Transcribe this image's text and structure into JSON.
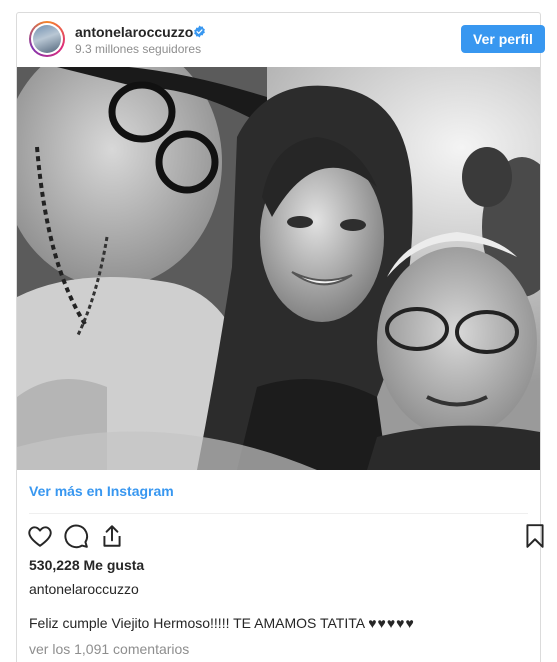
{
  "header": {
    "username": "antonelaroccuzzo",
    "followers": "9.3 millones seguidores",
    "follow_button": "Ver perfil"
  },
  "post": {
    "image_description_icon": "photo",
    "view_more": "Ver más en Instagram",
    "likes": "530,228 Me gusta",
    "author": "antonelaroccuzzo",
    "caption": "Feliz cumple Viejito Hermoso!!!!! TE AMAMOS TATITA",
    "caption_hearts": "♥♥♥♥♥",
    "comments": "ver los 1,091 comentarios"
  },
  "colors": {
    "accent": "#3897f0",
    "text": "#262626",
    "muted": "#8e8e8e"
  },
  "icons": [
    "heart-icon",
    "comment-icon",
    "share-icon",
    "bookmark-icon",
    "verified-badge-icon"
  ]
}
